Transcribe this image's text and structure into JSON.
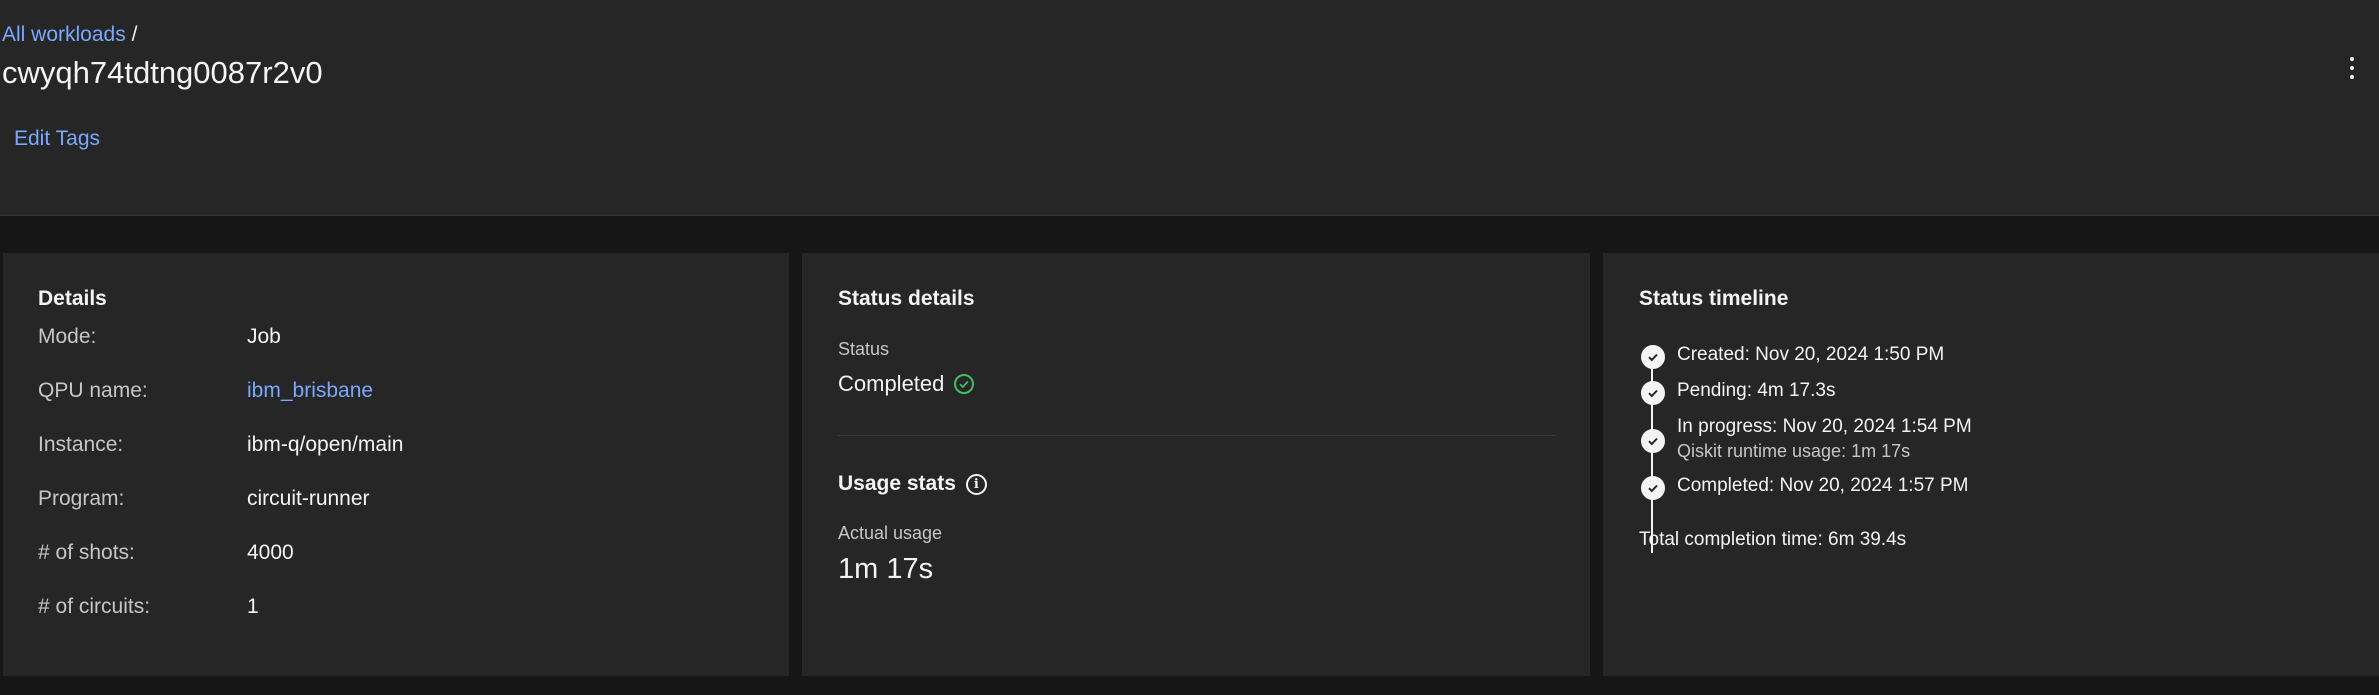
{
  "breadcrumb": {
    "parent_link": "All workloads",
    "separator": "/"
  },
  "page_title": "cwyqh74tdtng0087r2v0",
  "header_actions": {
    "edit_tags": "Edit Tags",
    "overflow_icon": "overflow-menu-vertical-icon"
  },
  "details": {
    "title": "Details",
    "rows": [
      {
        "label": "Mode:",
        "value": "Job"
      },
      {
        "label": "QPU name:",
        "value": "ibm_brisbane"
      },
      {
        "label": "Instance:",
        "value": "ibm-q/open/main"
      },
      {
        "label": "Program:",
        "value": "circuit-runner"
      },
      {
        "label": "# of shots:",
        "value": "4000"
      },
      {
        "label": "# of circuits:",
        "value": "1"
      }
    ]
  },
  "status_details": {
    "title": "Status details",
    "status_label": "Status",
    "status_value": "Completed",
    "status_icon": "checkmark-outline-icon",
    "status_color": "#42be65",
    "usage_title": "Usage stats",
    "usage_info_icon": "information-icon",
    "actual_usage_label": "Actual usage",
    "actual_usage_value": "1m 17s"
  },
  "status_timeline": {
    "title": "Status timeline",
    "events": [
      {
        "text": "Created: Nov 20, 2024 1:50 PM"
      },
      {
        "text": "Pending: 4m 17.3s"
      },
      {
        "text": "In progress: Nov 20, 2024 1:54 PM",
        "sub": "Qiskit runtime usage: 1m 17s"
      },
      {
        "text": "Completed: Nov 20, 2024 1:57 PM"
      }
    ],
    "total": "Total completion time: 6m 39.4s"
  },
  "colors": {
    "background": "#161616",
    "panel": "#262626",
    "link": "#78a9ff",
    "success": "#42be65",
    "text_primary": "#f4f4f4",
    "text_secondary": "#c6c6c6"
  }
}
